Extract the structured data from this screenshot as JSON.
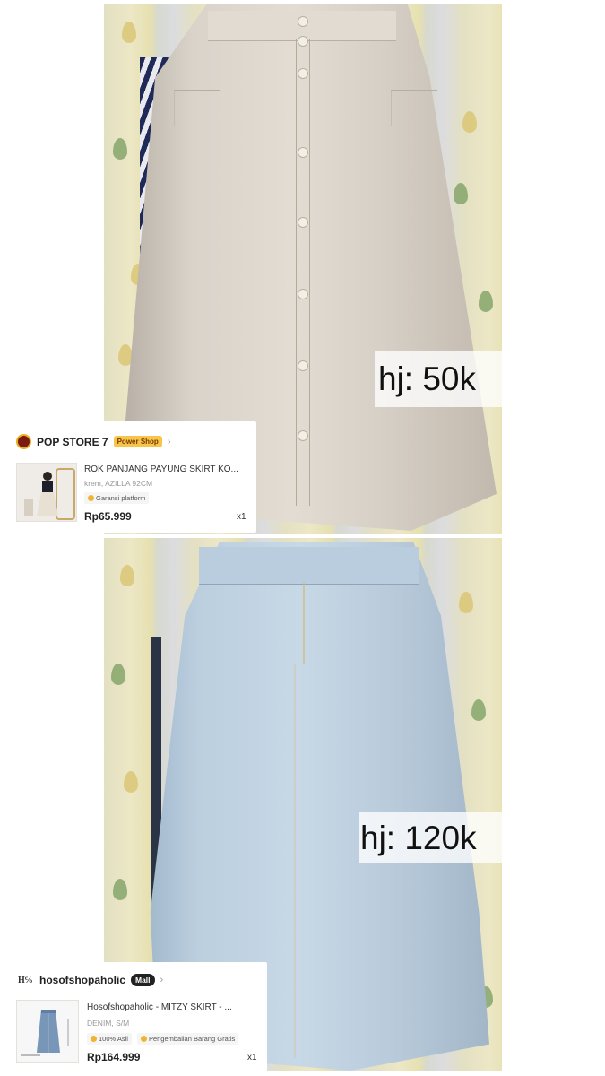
{
  "photos": [
    {
      "subject": "cream button-front long skirt",
      "price_label": "hj: 50k"
    },
    {
      "subject": "light blue denim long skirt",
      "price_label": "hj: 120k"
    }
  ],
  "orders": [
    {
      "shop_name": "POP STORE 7",
      "shop_badge": "Power Shop",
      "chevron": "›",
      "product_title": "ROK PANJANG PAYUNG SKIRT KO...",
      "variant": "krem, AZILLA 92CM",
      "guarantees": [
        "Garansi platform"
      ],
      "price": "Rp65.999",
      "quantity": "x1",
      "badge_color": "#f7c54a"
    },
    {
      "shop_name": "hosofshopaholic",
      "shop_badge": "Mall",
      "chevron": "›",
      "product_title": "Hosofshopaholic - MITZY SKIRT - ...",
      "variant": "DENIM, S/M",
      "guarantees": [
        "100% Asli",
        "Pengembalian Barang Gratis"
      ],
      "price": "Rp164.999",
      "quantity": "x1",
      "badge_color": "#222222"
    }
  ]
}
